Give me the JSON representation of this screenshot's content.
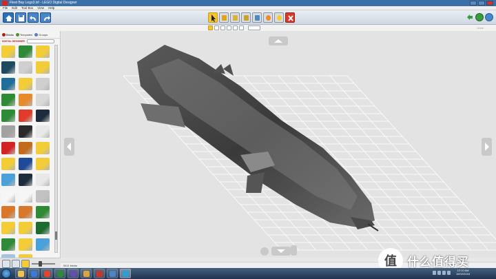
{
  "window": {
    "title": "Fleet Bay Lego3.lxf - LEGO Digital Designer"
  },
  "menu": [
    "File",
    "Edit",
    "Tool Box",
    "View",
    "Help"
  ],
  "toolbar": {
    "tools": [
      "select-icon",
      "clone-icon",
      "hinge-icon",
      "hinge-align-icon",
      "flex-icon",
      "paint-icon",
      "hide-icon",
      "delete-icon"
    ],
    "active_tool": 0
  },
  "subtoolbar": {
    "undo_label": "Undo"
  },
  "sidebar": {
    "tabs": [
      {
        "label": "Bricks"
      },
      {
        "label": "Templates"
      },
      {
        "label": "Groups"
      }
    ],
    "brand": "DIGITAL DESIGNER",
    "palette_colors": [
      "#f2cd37",
      "#2e8a34",
      "#f2cd37",
      "#1e4a60",
      "#cfcfcf",
      "#f2cd37",
      "#1f6e9a",
      "#f2cd37",
      "#cfcfcf",
      "#2e8a34",
      "#e78a2a",
      "#d9d9d9",
      "#2e8a34",
      "#e13b2b",
      "#1c2c3c",
      "#a2a2a2",
      "#2a2a2a",
      "#e8e8e8",
      "#d22323",
      "#c46a1c",
      "#f2cd37",
      "#f2cd37",
      "#1e4a9a",
      "#f2cd37",
      "#4aa0d8",
      "#1c2c3c",
      "#e8e8e8",
      "#f6f6f6",
      "#f6f6f6",
      "#c2c2c2",
      "#d9772a",
      "#d9772a",
      "#2e8a34",
      "#f2cd37",
      "#f2cd37",
      "#1e6b30",
      "#2e8a34",
      "#f2cd37",
      "#4aa0d8",
      "#a6c4e0",
      "#f2cd37",
      "#f6f6f6"
    ]
  },
  "statusbar": {
    "text": "5411 bricks"
  },
  "taskbar": {
    "apps": [
      "explorer-icon",
      "media-icon",
      "chrome-icon",
      "photos-icon",
      "game-icon",
      "ship-icon",
      "lego-icon",
      "app-icon",
      "ldd-icon"
    ],
    "time": "12:10 AM",
    "date": "16/02/2018"
  },
  "watermark": {
    "badge": "值",
    "text": "什么值得买"
  },
  "colors": {
    "titlebar": "#3b6fa8",
    "toolbar_active": "#f3c534",
    "viewport": "#e3e3e3"
  }
}
